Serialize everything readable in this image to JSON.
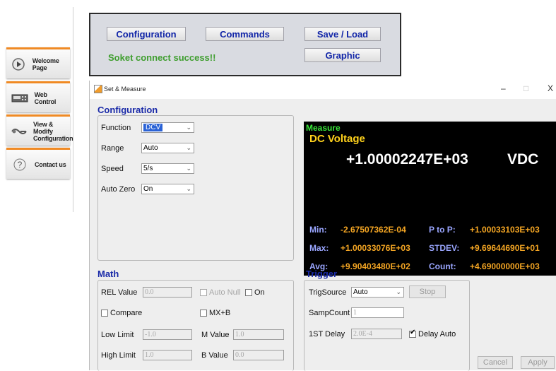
{
  "nav": [
    {
      "label_lines": [
        "Welcome Page"
      ],
      "icon": "play-icon"
    },
    {
      "label_lines": [
        "Web Control"
      ],
      "icon": "panel-icon"
    },
    {
      "label_lines": [
        "View & Modify",
        "Configuration"
      ],
      "icon": "probe-icon"
    },
    {
      "label_lines": [
        "Contact us"
      ],
      "icon": "question-icon"
    }
  ],
  "toolbar": {
    "configuration": "Configuration",
    "commands": "Commands",
    "save_load": "Save / Load",
    "graphic": "Graphic",
    "status": "Soket connect success!!"
  },
  "window": {
    "title": "Set & Measure",
    "min": "–",
    "max": "□",
    "close": "X"
  },
  "config": {
    "title": "Configuration",
    "function_label": "Function",
    "function_value": "DCV",
    "range_label": "Range",
    "range_value": "Auto",
    "speed_label": "Speed",
    "speed_value": "5/s",
    "autozero_label": "Auto Zero",
    "autozero_value": "On"
  },
  "measure": {
    "title": "Measure",
    "mode": "DC Voltage",
    "value": "+1.00002247E+03",
    "unit": "VDC",
    "min_label": "Min:",
    "min_value": "-2.67507362E-04",
    "ptop_label": "P to P:",
    "ptop_value": "+1.00033103E+03",
    "max_label": "Max:",
    "max_value": "+1.00033076E+03",
    "stdev_label": "STDEV:",
    "stdev_value": "+9.69644690E+01",
    "avg_label": "Avg:",
    "avg_value": "+9.90403480E+02",
    "count_label": "Count:",
    "count_value": "+4.69000000E+03"
  },
  "math": {
    "title": "Math",
    "rel_label": "REL Value",
    "rel_value": "0.0",
    "autonull_label": "Auto Null",
    "on_label": "On",
    "compare_label": "Compare",
    "mxb_label": "MX+B",
    "low_label": "Low Limit",
    "low_value": "-1.0",
    "m_label": "M Value",
    "m_value": "1.0",
    "high_label": "High Limit",
    "high_value": "1.0",
    "b_label": "B Value",
    "b_value": "0.0"
  },
  "trigger": {
    "title": "Trigger",
    "source_label": "TrigSource",
    "source_value": "Auto",
    "stop": "Stop",
    "count_label": "SampCount",
    "count_value": "1",
    "delay_label": "1ST Delay",
    "delay_value": "2.0E-4",
    "delayauto_label": "Delay Auto"
  },
  "footer": {
    "cancel": "Cancel",
    "apply": "Apply"
  },
  "colors": {
    "accent_orange": "#f08a24",
    "link_blue": "#1226a8",
    "status_green": "#3f9e2f",
    "measure_green": "#39e639",
    "measure_yellow": "#ffd21c",
    "measure_orange": "#f5a623",
    "measure_label": "#9aa6ff"
  }
}
